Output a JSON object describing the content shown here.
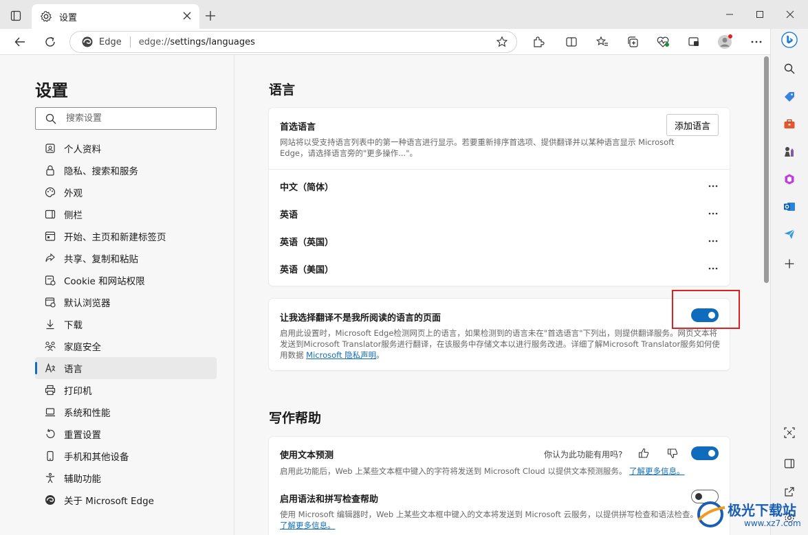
{
  "tab": {
    "title": "设置"
  },
  "address": {
    "site": "Edge",
    "url_prefix": "edge://",
    "url_path": "settings/languages"
  },
  "nav": {
    "title": "设置",
    "search_placeholder": "搜索设置",
    "items": [
      {
        "label": "个人资料",
        "icon": "profile-icon"
      },
      {
        "label": "隐私、搜索和服务",
        "icon": "lock-icon"
      },
      {
        "label": "外观",
        "icon": "palette-icon"
      },
      {
        "label": "侧栏",
        "icon": "sidebar-icon"
      },
      {
        "label": "开始、主页和新建标签页",
        "icon": "home-icon"
      },
      {
        "label": "共享、复制和粘贴",
        "icon": "share-icon"
      },
      {
        "label": "Cookie 和网站权限",
        "icon": "site-permissions-icon"
      },
      {
        "label": "默认浏览器",
        "icon": "browser-icon"
      },
      {
        "label": "下载",
        "icon": "download-icon"
      },
      {
        "label": "家庭安全",
        "icon": "family-icon"
      },
      {
        "label": "语言",
        "icon": "language-icon",
        "active": true
      },
      {
        "label": "打印机",
        "icon": "printer-icon"
      },
      {
        "label": "系统和性能",
        "icon": "laptop-icon"
      },
      {
        "label": "重置设置",
        "icon": "reset-icon"
      },
      {
        "label": "手机和其他设备",
        "icon": "phone-icon"
      },
      {
        "label": "辅助功能",
        "icon": "accessibility-icon"
      },
      {
        "label": "关于 Microsoft Edge",
        "icon": "edge-icon"
      }
    ]
  },
  "languages": {
    "section_title": "语言",
    "preferred": {
      "title": "首选语言",
      "desc": "网站将以受支持语言列表中的第一种语言进行显示。若要重新排序首选项、提供翻译并以某种语言显示 Microsoft Edge，请选择语言旁的\"更多操作...\"。",
      "add_button": "添加语言",
      "items": [
        "中文（简体）",
        "英语",
        "英语（英国）",
        "英语（美国）"
      ]
    },
    "translate": {
      "title": "让我选择翻译不是我所阅读的语言的页面",
      "desc": "启用此设置时，Microsoft Edge检测网页上的语言，如果检测到的语言未在\"首选语言\"下列出，则提供翻译服务。网页文本将发送到Microsoft Translator服务进行翻译，在该服务中存储文本以进行服务改进。详细了解Microsoft Translator服务如何使用数据",
      "link": "Microsoft 隐私声明",
      "trail": "。",
      "enabled": true
    }
  },
  "writing": {
    "section_title": "写作帮助",
    "prediction": {
      "title": "使用文本预测",
      "feedback": "你认为此功能有用吗?",
      "desc": "启用此功能后，Web 上某些文本框中键入的字符将发送到 Microsoft Cloud 以提供文本预测服务。",
      "link": "了解更多信息。",
      "enabled": true
    },
    "spellcheck": {
      "title": "启用语法和拼写检查帮助",
      "desc": "使用 Microsoft 编辑器时，Web 上某些文本框中键入的文本将发送到 Microsoft 云服务，以提供拼写检查和语法检查。",
      "link": "了解更多信息。",
      "enabled": false
    }
  },
  "watermark": {
    "name": "极光下载站",
    "url": "www.xz7.com"
  },
  "colors": {
    "accent": "#0f6cbd",
    "highlight": "#e0201e"
  }
}
